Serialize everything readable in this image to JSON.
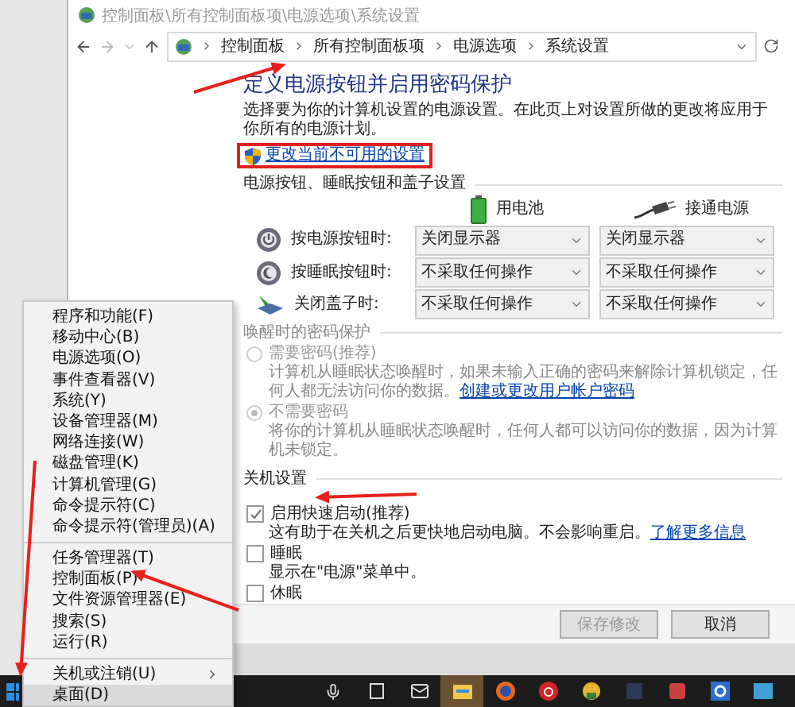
{
  "window": {
    "title": "控制面板\\所有控制面板项\\电源选项\\系统设置",
    "breadcrumb": [
      "控制面板",
      "所有控制面板项",
      "电源选项",
      "系统设置"
    ],
    "heading": "定义电源按钮并启用密码保护",
    "description": "选择要为你的计算机设置的电源设置。在此页上对设置所做的更改将应用于你所有的电源计划。",
    "admin_link": "更改当前不可用的设置",
    "buttons_section": {
      "label": "电源按钮、睡眠按钮和盖子设置",
      "columns": [
        "用电池",
        "接通电源"
      ],
      "rows": [
        {
          "kind": "power",
          "label": "按电源按钮时:",
          "battery": "关闭显示器",
          "plugged": "关闭显示器"
        },
        {
          "kind": "sleep",
          "label": "按睡眠按钮时:",
          "battery": "不采取任何操作",
          "plugged": "不采取任何操作"
        },
        {
          "kind": "lid",
          "label": "关闭盖子时:",
          "battery": "不采取任何操作",
          "plugged": "不采取任何操作"
        }
      ]
    },
    "password_section": {
      "label": "唤醒时的密码保护",
      "disabled": true,
      "options": [
        {
          "label": "需要密码(推荐)",
          "selected": false,
          "text": "计算机从睡眠状态唤醒时，如果未输入正确的密码来解除计算机锁定，任何人都无法访问你的数据。",
          "link": "创建或更改用户帐户密码"
        },
        {
          "label": "不需要密码",
          "selected": true,
          "text": "将你的计算机从睡眠状态唤醒时，任何人都可以访问你的数据，因为计算机未锁定。"
        }
      ]
    },
    "shutdown_section": {
      "label": "关机设置",
      "options": [
        {
          "label": "启用快速启动(推荐)",
          "checked": true,
          "text": "这有助于在关机之后更快地启动电脑。不会影响重启。",
          "link": "了解更多信息"
        },
        {
          "label": "睡眠",
          "checked": false,
          "text": "显示在\"电源\"菜单中。"
        },
        {
          "label": "休眠",
          "checked": false
        }
      ]
    },
    "footer_buttons": [
      {
        "label": "保存修改",
        "disabled": true
      },
      {
        "label": "取消",
        "disabled": false
      }
    ]
  },
  "context_menu": {
    "groups": [
      [
        {
          "label": "程序和功能(F)",
          "selected": false
        },
        {
          "label": "移动中心(B)",
          "selected": false
        },
        {
          "label": "电源选项(O)",
          "selected": false
        },
        {
          "label": "事件查看器(V)",
          "selected": false
        },
        {
          "label": "系统(Y)",
          "selected": false
        },
        {
          "label": "设备管理器(M)",
          "selected": false
        },
        {
          "label": "网络连接(W)",
          "selected": false
        },
        {
          "label": "磁盘管理(K)",
          "selected": false
        },
        {
          "label": "计算机管理(G)",
          "selected": false
        },
        {
          "label": "命令提示符(C)",
          "selected": false
        },
        {
          "label": "命令提示符(管理员)(A)",
          "selected": false
        }
      ],
      [
        {
          "label": "任务管理器(T)",
          "selected": false
        },
        {
          "label": "控制面板(P)",
          "selected": false
        },
        {
          "label": "文件资源管理器(E)",
          "selected": false
        },
        {
          "label": "搜索(S)",
          "selected": false
        },
        {
          "label": "运行(R)",
          "selected": false
        }
      ],
      [
        {
          "label": "关机或注销(U)",
          "selected": false,
          "submenu": true
        },
        {
          "label": "桌面(D)",
          "selected": true
        }
      ]
    ]
  }
}
